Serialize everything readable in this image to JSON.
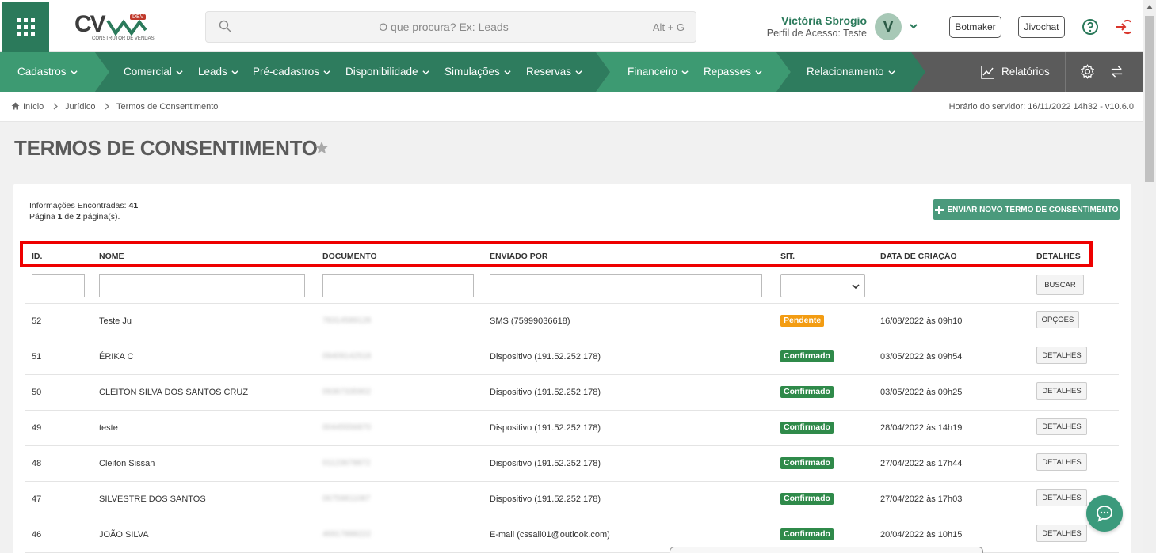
{
  "header": {
    "logo_text": "CV",
    "logo_sub": "CONSTRUTOR DE VENDAS",
    "logo_badge": "DEV",
    "search_placeholder": "O que procura? Ex: Leads",
    "search_shortcut": "Alt + G",
    "user_name": "Victória Sbrogio",
    "user_profile": "Perfil de Acesso: Teste",
    "avatar_letter": "V",
    "botmaker_label": "Botmaker",
    "jivochat_label": "Jivochat"
  },
  "nav": {
    "items": [
      "Cadastros",
      "Comercial",
      "Leads",
      "Pré-cadastros",
      "Disponibilidade",
      "Simulações",
      "Reservas",
      "Financeiro",
      "Repasses",
      "Relacionamento"
    ],
    "reports_label": "Relatórios"
  },
  "breadcrumb": {
    "home": "Início",
    "level1": "Jurídico",
    "level2": "Termos de Consentimento",
    "server_time": "Horário do servidor: 16/11/2022 14h32 - v10.6.0"
  },
  "page": {
    "title": "TERMOS DE CONSENTIMENTO",
    "info_found_label": "Informações Encontradas:",
    "info_found_value": "41",
    "page_prefix": "Página",
    "page_current": "1",
    "page_of": "de",
    "page_total": "2",
    "page_suffix": "página(s).",
    "add_button": "ENVIAR NOVO TERMO DE CONSENTIMENTO"
  },
  "table": {
    "headers": [
      "ID.",
      "NOME",
      "DOCUMENTO",
      "ENVIADO POR",
      "SIT.",
      "DATA DE CRIAÇÃO",
      "DETALHES"
    ],
    "search_button": "BUSCAR",
    "rows": [
      {
        "id": "52",
        "nome": "Teste Ju",
        "doc": "78314589128",
        "enviado": "SMS (75999036618)",
        "sit": "Pendente",
        "data": "16/08/2022 às 09h10",
        "acao": "OPÇÕES"
      },
      {
        "id": "51",
        "nome": "ÉRIKA C",
        "doc": "09409142518",
        "enviado": "Dispositivo (191.52.252.178)",
        "sit": "Confirmado",
        "data": "03/05/2022 às 09h54",
        "acao": "DETALHES"
      },
      {
        "id": "50",
        "nome": "CLEITON SILVA DOS SANTOS CRUZ",
        "doc": "09367335902",
        "enviado": "Dispositivo (191.52.252.178)",
        "sit": "Confirmado",
        "data": "03/05/2022 às 09h25",
        "acao": "DETALHES"
      },
      {
        "id": "49",
        "nome": "teste",
        "doc": "00445556870",
        "enviado": "Dispositivo (191.52.252.178)",
        "sit": "Confirmado",
        "data": "28/04/2022 às 14h19",
        "acao": "DETALHES"
      },
      {
        "id": "48",
        "nome": "Cleiton Sissan",
        "doc": "01123678872",
        "enviado": "Dispositivo (191.52.252.178)",
        "sit": "Confirmado",
        "data": "27/04/2022 às 17h44",
        "acao": "DETALHES"
      },
      {
        "id": "47",
        "nome": "SILVESTRE DOS SANTOS",
        "doc": "06759811087",
        "enviado": "Dispositivo (191.52.252.178)",
        "sit": "Confirmado",
        "data": "27/04/2022 às 17h03",
        "acao": "DETALHES"
      },
      {
        "id": "46",
        "nome": "JOÃO SILVA",
        "doc": "46917888222",
        "enviado": "E-mail (cssali01@outlook.com)",
        "sit": "Confirmado",
        "data": "20/04/2022 às 10h15",
        "acao": "DETALHES"
      }
    ]
  },
  "colors": {
    "brand_green": "#2b7a5b",
    "nav_green": "#3d9a72",
    "pending": "#f39c12",
    "confirmed": "#2f8a4a",
    "highlight": "#e00000"
  }
}
